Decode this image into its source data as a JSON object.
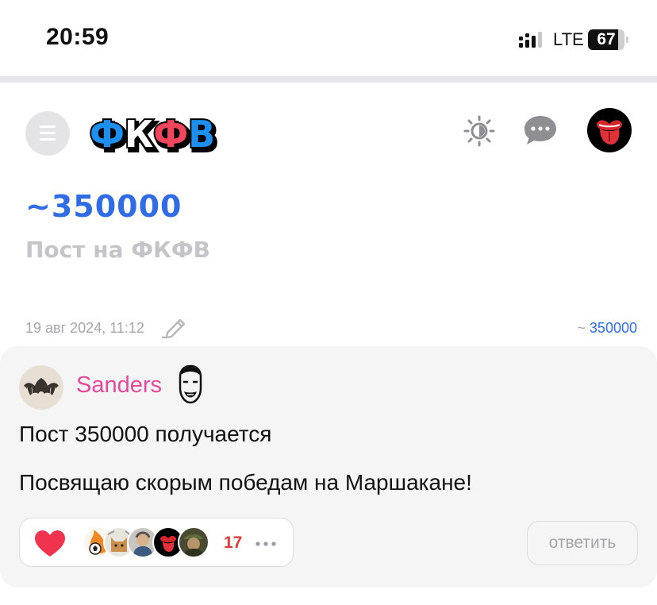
{
  "status_bar": {
    "time": "20:59",
    "network": "LTE",
    "battery": "67"
  },
  "header": {
    "logo_text": "ФКФВ",
    "icons": [
      "menu-icon",
      "theme-toggle-icon",
      "chat-icon",
      "rolling-stones-tongue-avatar"
    ]
  },
  "tag": {
    "title": "~350000",
    "subtitle": "Пост на ФКФВ"
  },
  "post": {
    "date": "19 авг 2024, 11:12",
    "tag_tilde": "~",
    "tag_value": "350000",
    "author": "Sanders",
    "line1": "Пост 350000 получается",
    "line2": "Посвящаю скорым победам на Маршакане!",
    "likes": "17",
    "reply_label": "ответить"
  },
  "colors": {
    "accent_blue": "#2f6ce6",
    "author_pink": "#e4489a",
    "like_red": "#e03a3a",
    "heart": "#f0344f"
  }
}
